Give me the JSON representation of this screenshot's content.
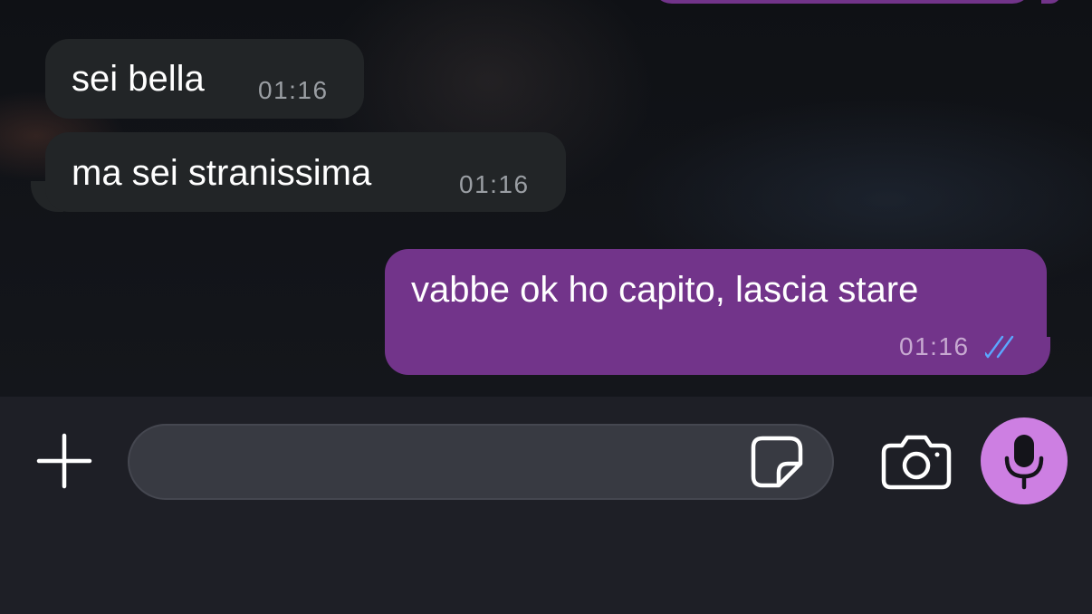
{
  "messages": [
    {
      "direction": "incoming",
      "text": "sei bella",
      "time": "01:16"
    },
    {
      "direction": "incoming",
      "text": "ma sei stranissima",
      "time": "01:16"
    },
    {
      "direction": "outgoing",
      "text": "vabbe ok ho capito, lascia stare",
      "time": "01:16",
      "status": "read",
      "status_icon": "double-check-icon"
    }
  ],
  "composer": {
    "input_value": "",
    "input_placeholder": "",
    "icons": {
      "attach": "plus-icon",
      "sticker": "sticker-icon",
      "camera": "camera-icon",
      "voice": "microphone-icon"
    }
  },
  "colors": {
    "incoming_bubble": "#222527",
    "outgoing_bubble": "#72348a",
    "read_ticks": "#5ba7ff",
    "mic_button": "#cd7fe2",
    "composer_bg": "#1e1f26",
    "input_bg": "#383a42"
  }
}
